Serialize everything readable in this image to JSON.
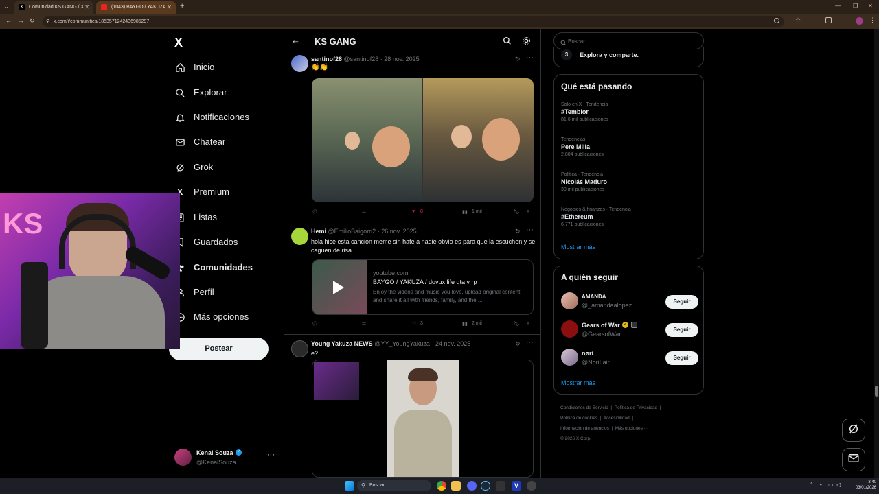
{
  "browser": {
    "tabs": [
      {
        "title": "Comunidad KS GANG / X"
      },
      {
        "title": "(1043) BAYGO / YAKUZA / dovu..."
      }
    ],
    "url": "x.com/i/communities/1853571242436985297"
  },
  "sidebar": {
    "logo": "X",
    "items": [
      {
        "label": "Inicio",
        "icon": "home-icon"
      },
      {
        "label": "Explorar",
        "icon": "search-icon"
      },
      {
        "label": "Notificaciones",
        "icon": "bell-icon"
      },
      {
        "label": "Chatear",
        "icon": "mail-icon"
      },
      {
        "label": "Grok",
        "icon": "grok-icon"
      },
      {
        "label": "Premium",
        "icon": "x-icon"
      },
      {
        "label": "Listas",
        "icon": "list-icon"
      },
      {
        "label": "Guardados",
        "icon": "bookmark-icon"
      },
      {
        "label": "Comunidades",
        "icon": "communities-icon"
      },
      {
        "label": "Perfil",
        "icon": "user-icon"
      },
      {
        "label": "Más opciones",
        "icon": "more-icon"
      }
    ],
    "post_button": "Postear",
    "account": {
      "name": "Kenai Souza",
      "handle": "@KenaiSouza"
    }
  },
  "header": {
    "title": "KS GANG"
  },
  "posts": [
    {
      "author": "santinof28",
      "handle": "@santinof28",
      "date": "28 nov. 2025",
      "text": "👏👏",
      "likes": "8",
      "views": "1 mil"
    },
    {
      "author": "Hemi",
      "handle": "@EmilioBaigorri2",
      "date": "26 nov. 2025",
      "text": "hola hice esta cancion meme sin hate a nadie obvio es para que la escuchen y se caguen de risa",
      "card": {
        "domain": "youtube.com",
        "title": "BAYGO / YAKUZA / dovux life gta v rp",
        "desc": "Enjoy the videos and music you love, upload original content, and share it all with friends, family, and the ..."
      },
      "likes": "3",
      "views": "2 mil"
    },
    {
      "author": "Young Yakuza NEWS",
      "handle": "@YY_YoungYakuza",
      "date": "24 nov. 2025",
      "text": "e?"
    }
  ],
  "right": {
    "search_placeholder": "Buscar",
    "step": {
      "num": "3",
      "text": "Explora y comparte."
    },
    "trending": {
      "title": "Qué está pasando",
      "items": [
        {
          "meta": "Solo en X · Tendencia",
          "topic": "#Temblor",
          "count": "81,6 mil publicaciones"
        },
        {
          "meta": "Tendencias",
          "topic": "Pere Milla",
          "count": "2.804 publicaciones"
        },
        {
          "meta": "Política · Tendencia",
          "topic": "Nicolás Maduro",
          "count": "30 mil publicaciones"
        },
        {
          "meta": "Negocios & finanzas · Tendencia",
          "topic": "#Ethereum",
          "count": "6.771 publicaciones"
        }
      ],
      "more": "Mostrar más"
    },
    "follow": {
      "title": "A quién seguir",
      "items": [
        {
          "name": "AMANDA",
          "handle": "@_amandaalopez",
          "btn": "Seguir"
        },
        {
          "name": "Gears of War",
          "handle": "@GearsofWar",
          "btn": "Seguir"
        },
        {
          "name": "nøri",
          "handle": "@NoriLair",
          "btn": "Seguir"
        }
      ],
      "more": "Mostrar más"
    },
    "footer": {
      "links": [
        "Condiciones de Servicio",
        "Política de Privacidad",
        "Política de cookies",
        "Accesibilidad",
        "Información de anuncios",
        "Más opciones ···"
      ],
      "copyright": "© 2026 X Corp."
    }
  },
  "taskbar": {
    "search": "Buscar",
    "time": "3:40",
    "date": "03/01/2026"
  },
  "colors": {
    "bg": "#000000",
    "accent": "#1d9bf0",
    "link": "#1d9bf0",
    "like": "#f91880"
  }
}
